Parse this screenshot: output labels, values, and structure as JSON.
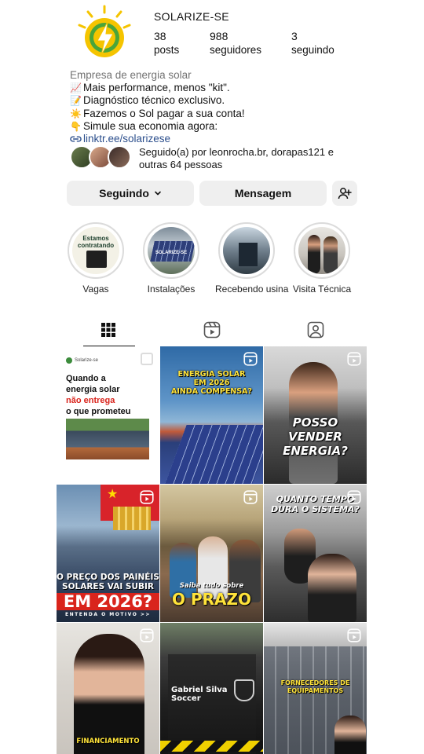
{
  "profile": {
    "username": "SOLARIZE-SE",
    "posts_count": "38",
    "posts_label": "posts",
    "followers_count": "988",
    "followers_label": "seguidores",
    "following_count": "3",
    "following_label": "seguindo"
  },
  "bio": {
    "category": "Empresa de energia solar",
    "lines": [
      {
        "icon": "chart-up-icon",
        "text": "Mais performance, menos \"kit\"."
      },
      {
        "icon": "memo-icon",
        "text": "Diagnóstico técnico exclusivo."
      },
      {
        "icon": "sun-icon",
        "text": "Fazemos o Sol pagar a sua conta!"
      },
      {
        "icon": "pointing-hand-icon",
        "text": "Simule sua economia agora:"
      }
    ],
    "link": "linktr.ee/solarizese"
  },
  "followed_by": {
    "prefix": "Seguido(a) por ",
    "names": "leonrocha.br, dorapas121",
    "connector": " e",
    "others": "outras 64 pessoas"
  },
  "buttons": {
    "following": "Seguindo",
    "message": "Mensagem"
  },
  "highlights": [
    {
      "label": "Vagas",
      "cover_text": "Estamos contratando"
    },
    {
      "label": "Instalações",
      "cover_text": "SOLARIZE-SE"
    },
    {
      "label": "Recebendo usina"
    },
    {
      "label": "Visita Técnica"
    }
  ],
  "tabs": [
    "posts-grid",
    "reels",
    "tagged"
  ],
  "posts": [
    {
      "type": "carousel",
      "brand": "Solarize-se",
      "lines": [
        "Quando a",
        "energia solar",
        "não entrega",
        "o que  prometeu"
      ]
    },
    {
      "type": "reel",
      "caption": [
        "ENERGIA SOLAR",
        "EM 2026",
        "AINDA COMPENSA?"
      ]
    },
    {
      "type": "reel",
      "caption": [
        "POSSO VENDER",
        "ENERGIA?"
      ]
    },
    {
      "type": "reel",
      "caption_top": [
        "O PREÇO DOS PAINÉIS",
        "SOLARES VAI SUBIR"
      ],
      "caption_big": "EM 2026?",
      "caption_small": "ENTENDA O MOTIVO >>"
    },
    {
      "type": "reel",
      "caption_small": "Saiba tudo sobre",
      "caption_big": "O PRAZO"
    },
    {
      "type": "reel",
      "caption": [
        "QUANTO TEMPO",
        "DURA O SISTEMA?"
      ]
    },
    {
      "type": "reel",
      "caption": "FINANCIAMENTO"
    },
    {
      "type": "post",
      "caption": [
        "Gabriel Silva",
        "Soccer"
      ]
    },
    {
      "type": "reel",
      "caption": [
        "FORNECEDORES DE",
        "EQUIPAMENTOS"
      ]
    }
  ],
  "colors": {
    "accent_link": "#2b4e8c",
    "button_bg": "#efefef",
    "brand_green": "#3c8c3c",
    "brand_yellow": "#f5c400"
  }
}
